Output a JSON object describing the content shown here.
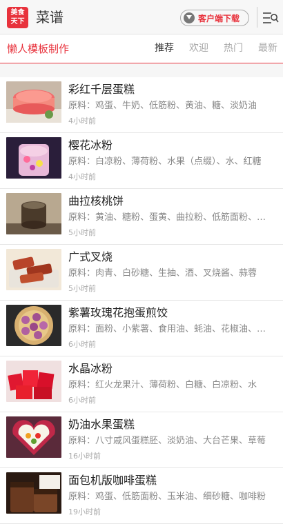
{
  "header": {
    "logo_line1": "美食",
    "logo_line2": "天下",
    "title": "菜谱",
    "download_label": "客户端下载"
  },
  "subnav": {
    "title": "懒人模板制作",
    "tabs": [
      "推荐",
      "欢迎",
      "热门",
      "最新"
    ],
    "active_tab": "推荐"
  },
  "recipes": [
    {
      "title": "彩红千层蛋糕",
      "ingredients": "原料：鸡蛋、牛奶、低筋粉、黄油、糖、淡奶油",
      "time": "4小时前"
    },
    {
      "title": "樱花冰粉",
      "ingredients": "原料：白凉粉、薄荷粉、水果（点缀）、水、红糖",
      "time": "4小时前"
    },
    {
      "title": "曲拉核桃饼",
      "ingredients": "原料：黄油、糖粉、蛋黄、曲拉粉、低筋面粉、核桃",
      "time": "5小时前"
    },
    {
      "title": "广式叉烧",
      "ingredients": "原料：肉青、白砂糖、生抽、酒、叉烧酱、蒜蓉",
      "time": "5小时前"
    },
    {
      "title": "紫薯玫瑰花抱蛋煎饺",
      "ingredients": "原料：面粉、小紫薯、食用油、蚝油、花椒油、鸡蛋",
      "time": "6小时前"
    },
    {
      "title": "水晶冰粉",
      "ingredients": "原料：红火龙果汁、薄荷粉、白糖、白凉粉、水",
      "time": "6小时前"
    },
    {
      "title": "奶油水果蛋糕",
      "ingredients": "原料：八寸戚风蛋糕胚、淡奶油、大台芒果、草莓",
      "time": "16小时前"
    },
    {
      "title": "面包机版咖啡蛋糕",
      "ingredients": "原料：鸡蛋、低筋面粉、玉米油、细砂糖、咖啡粉",
      "time": "19小时前"
    }
  ],
  "colors": {
    "accent": "#e8323c"
  }
}
